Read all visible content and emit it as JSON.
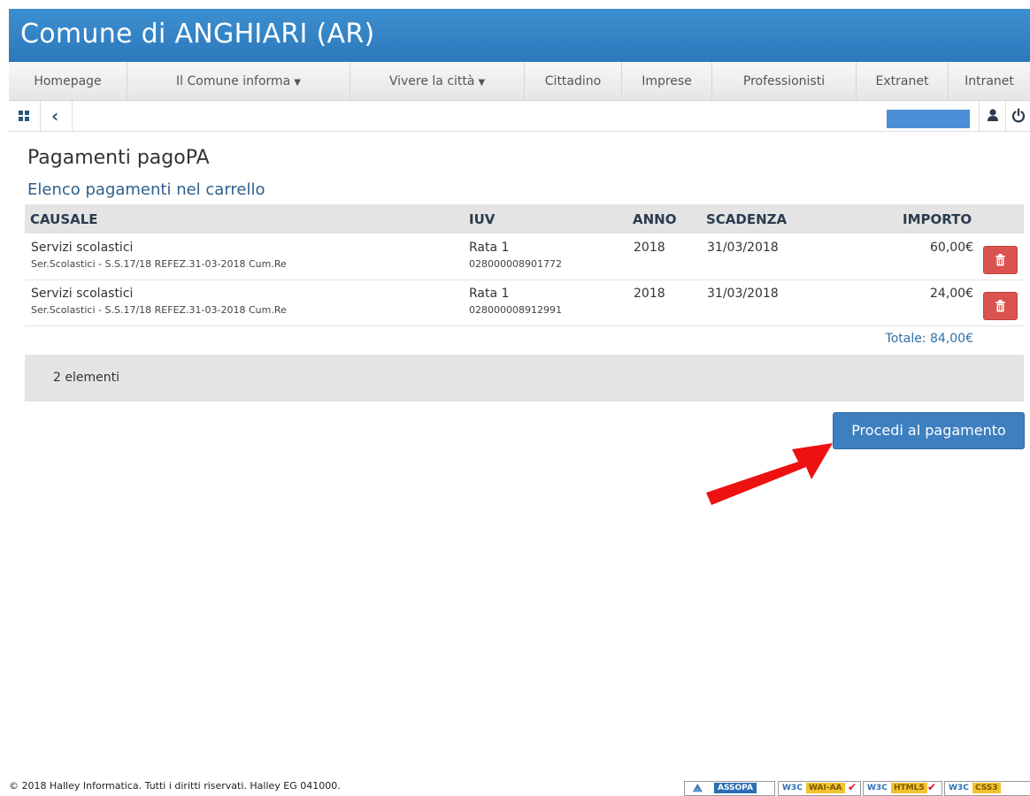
{
  "header": {
    "title": "Comune di ANGHIARI (AR)"
  },
  "menu": {
    "homepage": "Homepage",
    "comune_informa": "Il Comune informa",
    "vivere_citta": "Vivere la città",
    "cittadino": "Cittadino",
    "imprese": "Imprese",
    "professionisti": "Professionisti",
    "extranet": "Extranet",
    "intranet": "Intranet"
  },
  "toolbar": {
    "icons": [
      "grid-icon",
      "chevron-left-icon",
      "user-icon",
      "power-icon"
    ]
  },
  "page": {
    "title": "Pagamenti pagoPA",
    "section_title": "Elenco pagamenti nel carrello"
  },
  "table": {
    "headers": {
      "causale": "CAUSALE",
      "iuv": "IUV",
      "anno": "ANNO",
      "scadenza": "SCADENZA",
      "importo": "IMPORTO"
    },
    "rows": [
      {
        "causale": "Servizi scolastici",
        "causale_detail": "Ser.Scolastici - S.S.17/18 REFEZ.31-03-2018 Cum.Re",
        "iuv": "Rata 1",
        "iuv_code": "028000008901772",
        "anno": "2018",
        "scadenza": "31/03/2018",
        "importo": "60,00€"
      },
      {
        "causale": "Servizi scolastici",
        "causale_detail": "Ser.Scolastici - S.S.17/18 REFEZ.31-03-2018 Cum.Re",
        "iuv": "Rata 1",
        "iuv_code": "028000008912991",
        "anno": "2018",
        "scadenza": "31/03/2018",
        "importo": "24,00€"
      }
    ],
    "total": "Totale: 84,00€",
    "count": "2 elementi"
  },
  "actions": {
    "proceed": "Procedi al pagamento"
  },
  "footer": {
    "copyright": "© 2018 Halley Informatica. Tutti i diritti riservati. Halley EG 041000.",
    "badges": {
      "assopa": "ASSOPA",
      "wai_aa": "WAI-AA",
      "html5": "HTML5",
      "css3": "CSS3",
      "w3c": "W3C"
    }
  },
  "colors": {
    "header_blue": "#2c78bb",
    "button_blue": "#3d7fbf",
    "delete_red": "#d9534f",
    "arrow_red": "#ee1111"
  }
}
